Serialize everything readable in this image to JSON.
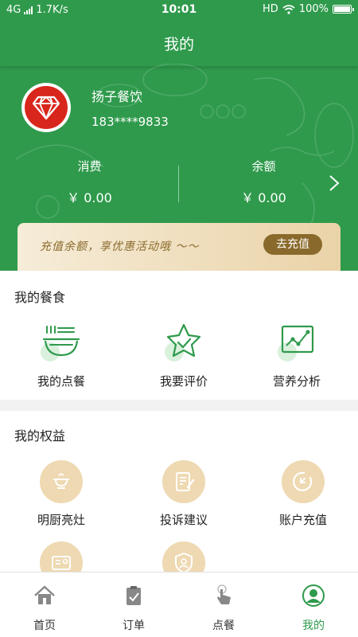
{
  "status_bar": {
    "network": "4G",
    "speed": "1.7K/s",
    "time": "10:01",
    "hd": "HD",
    "battery": "100%"
  },
  "header": {
    "title": "我的"
  },
  "profile": {
    "name": "扬子餐饮",
    "phone": "183****9833"
  },
  "stats": {
    "consumption_label": "消费",
    "consumption_value": "￥ 0.00",
    "balance_label": "余额",
    "balance_value": "￥ 0.00"
  },
  "banner": {
    "text": "充值余额，享优惠活动哦 ～～",
    "button": "去充值"
  },
  "meals": {
    "title": "我的餐食",
    "items": [
      {
        "label": "我的点餐",
        "icon": "bowl-icon"
      },
      {
        "label": "我要评价",
        "icon": "star-icon"
      },
      {
        "label": "营养分析",
        "icon": "chart-icon"
      }
    ]
  },
  "rights": {
    "title": "我的权益",
    "items": [
      {
        "label": "明厨亮灶",
        "icon": "cooking-pot-icon"
      },
      {
        "label": "投诉建议",
        "icon": "document-edit-icon"
      },
      {
        "label": "账户充值",
        "icon": "recharge-icon"
      },
      {
        "label": "",
        "icon": "id-card-icon"
      },
      {
        "label": "",
        "icon": "shield-user-icon"
      }
    ]
  },
  "tabs": [
    {
      "label": "首页",
      "icon": "home-icon"
    },
    {
      "label": "订单",
      "icon": "order-icon"
    },
    {
      "label": "点餐",
      "icon": "tap-icon"
    },
    {
      "label": "我的",
      "icon": "user-icon"
    }
  ],
  "colors": {
    "primary": "#2f9a4c",
    "gold": "#8a6a2c",
    "gold_light": "#eed9b2"
  }
}
